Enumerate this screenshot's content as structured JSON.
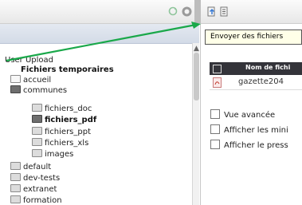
{
  "tooltip": {
    "text": "Envoyer des fichiers"
  },
  "tree": {
    "items": [
      {
        "label": "User Upload"
      },
      {
        "label": "Fichiers temporaires"
      },
      {
        "label": "accueil"
      },
      {
        "label": "communes"
      },
      {
        "label": "fichiers_doc"
      },
      {
        "label": "fichiers_pdf"
      },
      {
        "label": "fichiers_ppt"
      },
      {
        "label": "fichiers_xls"
      },
      {
        "label": "images"
      },
      {
        "label": "default"
      },
      {
        "label": "dev-tests"
      },
      {
        "label": "extranet"
      },
      {
        "label": "formation"
      }
    ]
  },
  "file_table": {
    "header_label": "Nom de fichi",
    "row_name": "gazette204"
  },
  "options": [
    {
      "label": "Vue avancée"
    },
    {
      "label": "Afficher les mini"
    },
    {
      "label": "Afficher le press"
    }
  ],
  "colors": {
    "arrow": "#1aa84a",
    "table_header": "#34343a",
    "tooltip_bg": "#ffffe8",
    "tree_header": "#d3dbe7"
  },
  "icons": [
    "refresh-icon",
    "help-icon",
    "upload-files-icon",
    "download-files-icon",
    "pdf-file-icon"
  ]
}
